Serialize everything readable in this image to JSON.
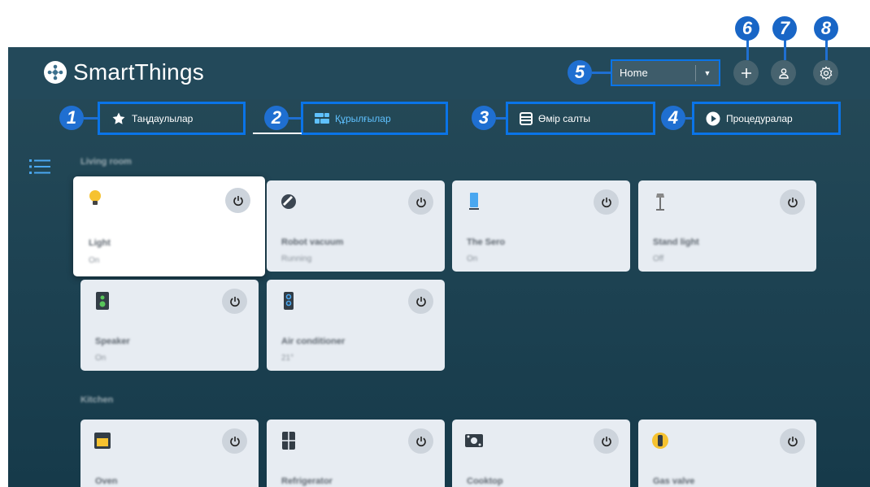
{
  "app": {
    "title": "SmartThings"
  },
  "location": {
    "selected": "Home"
  },
  "callouts": [
    "1",
    "2",
    "3",
    "4",
    "5",
    "6",
    "7",
    "8"
  ],
  "tabs": [
    {
      "label": "Таңдаулылар",
      "icon": "star-icon"
    },
    {
      "label": "Құрылғылар",
      "icon": "devices-grid-icon"
    },
    {
      "label": "Өмір салты",
      "icon": "life-icon"
    },
    {
      "label": "Процедуралар",
      "icon": "play-icon"
    }
  ],
  "sections": [
    {
      "title": "Living room",
      "devices": [
        {
          "name": "Light",
          "status": "On",
          "icon": "bulb-icon"
        },
        {
          "name": "Robot vacuum",
          "status": "Running",
          "icon": "vacuum-icon"
        },
        {
          "name": "The Sero",
          "status": "On",
          "icon": "tv-icon"
        },
        {
          "name": "Stand light",
          "status": "Off",
          "icon": "stand-lamp-icon"
        },
        {
          "name": "Speaker",
          "status": "On",
          "icon": "speaker-icon"
        },
        {
          "name": "Air conditioner",
          "status": "21°",
          "icon": "air-conditioner-icon"
        }
      ]
    },
    {
      "title": "Kitchen",
      "devices": [
        {
          "name": "Oven",
          "status": "",
          "icon": "oven-icon"
        },
        {
          "name": "Refrigerator",
          "status": "",
          "icon": "refrigerator-icon"
        },
        {
          "name": "Cooktop",
          "status": "",
          "icon": "cooktop-icon"
        },
        {
          "name": "Gas valve",
          "status": "",
          "icon": "gas-valve-icon"
        }
      ]
    }
  ],
  "colors": {
    "accent": "#0a74e8",
    "background": "#1f4454",
    "card": "#e7ecf2",
    "callout": "#1f6fd1"
  }
}
